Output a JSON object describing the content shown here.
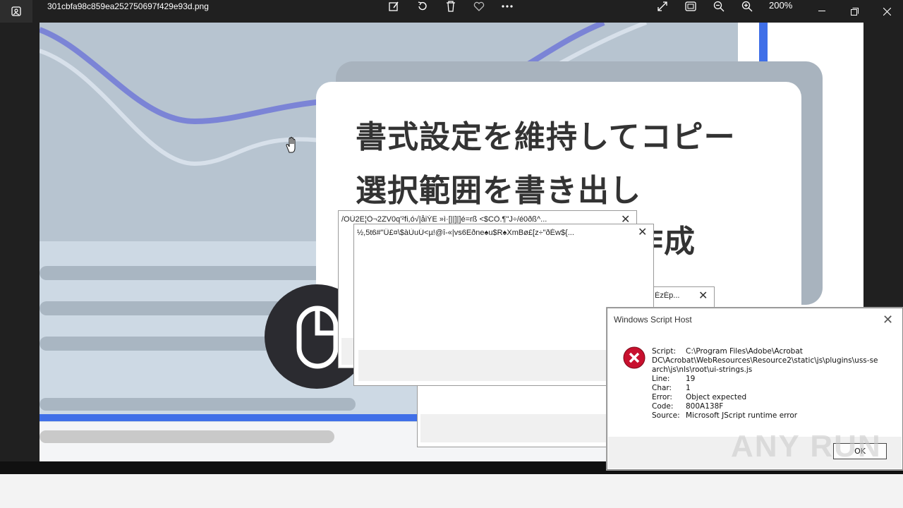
{
  "viewer": {
    "filename": "301cbfa98c859ea252750697f429e93d.png",
    "zoom": "200%",
    "icons": [
      "edit-icon",
      "rotate-icon",
      "delete-icon",
      "favorite-icon",
      "more-icon",
      "fullscreen-icon",
      "fit-icon",
      "zoom-out-icon",
      "zoom-in-icon",
      "minimize-icon",
      "maximize-icon",
      "close-icon"
    ]
  },
  "image": {
    "line1": "書式設定を維持してコピー",
    "line2": "選択範囲を書き出し",
    "line3_tail": "作成"
  },
  "dialogs": {
    "garbled1": "/OÙ2E¦Ò¬2ZV0q'²fi,ó√|åiÝE »ì·[||]|]é=rß <$CÒ.¶\"J÷/é0ðß^...",
    "garbled2": "½,5t6#\"Ü£¤\\$àÙuÚ<µ!@î-«|vs6Eðne♠u$R♠XmBø£[z÷\"ðÉw${...",
    "garbled3": "ÉzÉp..."
  },
  "wsh": {
    "title": "Windows Script Host",
    "script_label": "Script:",
    "script_value_1": "C:\\Program Files\\Adobe\\Acrobat",
    "script_value_2": "DC\\Acrobat\\WebResources\\Resource2\\static\\js\\plugins\\uss-se",
    "script_value_3": "arch\\js\\nls\\root\\ui-strings.js",
    "line_label": "Line:",
    "line_value": "19",
    "char_label": "Char:",
    "char_value": "1",
    "error_label": "Error:",
    "error_value": "Object expected",
    "code_label": "Code:",
    "code_value": "800A138F",
    "source_label": "Source:",
    "source_value": "Microsoft JScript runtime error",
    "ok_label": "OK"
  },
  "watermark": "ANY RUN",
  "colors": {
    "accent_blue": "#3f6fe8",
    "wave_purple": "#7b84d6",
    "error_red": "#c8102e"
  }
}
